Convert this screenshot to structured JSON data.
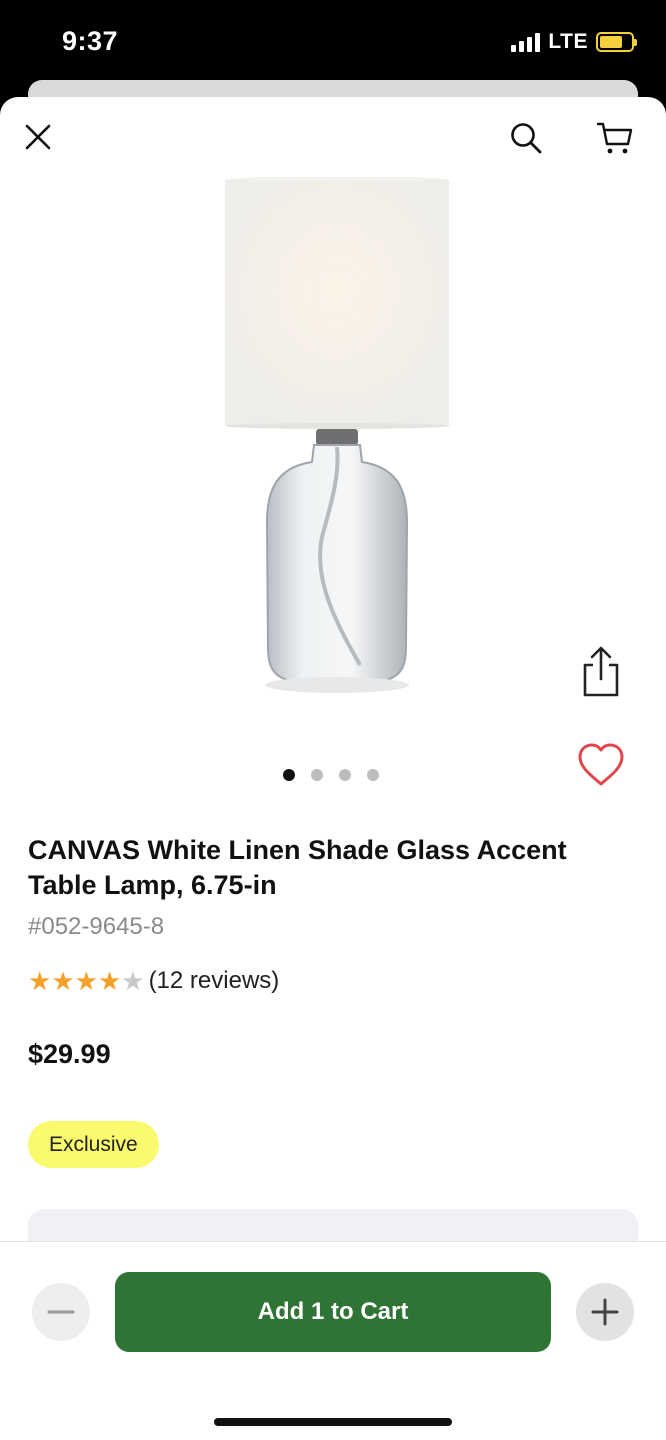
{
  "status_bar": {
    "time": "9:37",
    "network": "LTE"
  },
  "header": {
    "close_icon": "close-icon",
    "search_icon": "search-icon",
    "cart_icon": "cart-icon"
  },
  "product": {
    "title": "CANVAS White Linen Shade Glass Accent Table Lamp, 6.75-in",
    "sku": "#052-9645-8",
    "rating": 4,
    "rating_max": 5,
    "reviews": "(12 reviews)",
    "price": "$29.99",
    "badge": "Exclusive",
    "image_count": 4,
    "active_image": 1
  },
  "actions": {
    "share_icon": "share-icon",
    "favorite_icon": "heart-icon",
    "add_to_cart_label": "Add 1 to Cart",
    "minus_icon": "minus-icon",
    "plus_icon": "plus-icon"
  },
  "colors": {
    "primary_button": "#2f7434",
    "badge_bg": "#fafa6e",
    "star": "#f3a12b",
    "heart": "#e0474c"
  }
}
